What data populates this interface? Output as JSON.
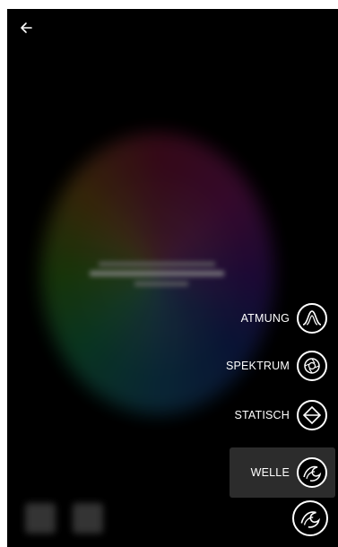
{
  "header": {
    "back_icon": "arrow-left-icon"
  },
  "modes": {
    "items": [
      {
        "label": "ATMUNG",
        "icon": "breathing-curve-icon",
        "selected": false
      },
      {
        "label": "SPEKTRUM",
        "icon": "spectrum-aperture-icon",
        "selected": false
      },
      {
        "label": "STATISCH",
        "icon": "static-diamond-icon",
        "selected": false
      },
      {
        "label": "WELLE",
        "icon": "wave-icon",
        "selected": true
      }
    ]
  },
  "fab": {
    "icon": "wave-icon"
  },
  "colors": {
    "background": "#000000",
    "foreground": "#ffffff",
    "selected_row": "#2c2c2c"
  }
}
